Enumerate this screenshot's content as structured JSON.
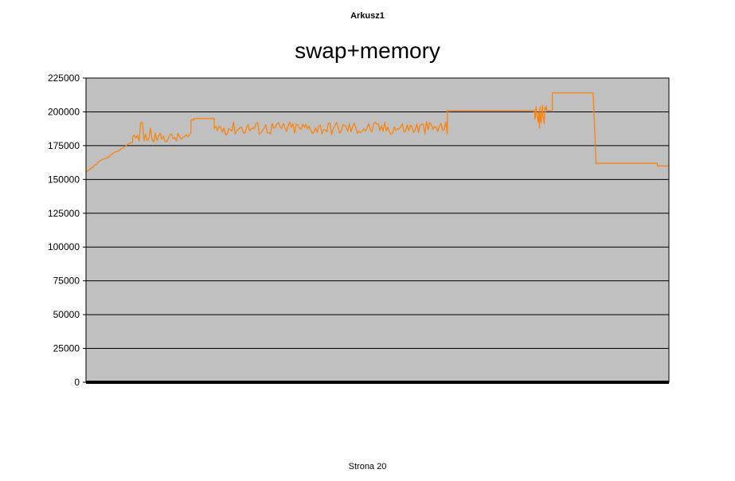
{
  "sheet_name": "Arkusz1",
  "page_label": "Strona 20",
  "chart_data": {
    "type": "line",
    "title": "swap+memory",
    "xlabel": "",
    "ylabel": "",
    "ylim": [
      0,
      225000
    ],
    "yticks": [
      0,
      25000,
      50000,
      75000,
      100000,
      125000,
      150000,
      175000,
      200000,
      225000
    ],
    "series": [
      {
        "name": "swap+memory",
        "color": "#ff7f00",
        "segments": [
          {
            "kind": "ramp",
            "x0": 0.0,
            "x1": 0.02,
            "y0": 155000,
            "y1": 162000
          },
          {
            "kind": "ramp",
            "x0": 0.02,
            "x1": 0.08,
            "y0": 162000,
            "y1": 178000
          },
          {
            "kind": "noisy",
            "x0": 0.08,
            "x1": 0.18,
            "base": 181000,
            "amp": 3500,
            "spikes": [
              {
                "x": 0.095,
                "y": 192000
              },
              {
                "x": 0.11,
                "y": 188000
              }
            ]
          },
          {
            "kind": "flat",
            "x0": 0.18,
            "x1": 0.185,
            "y": 194000
          },
          {
            "kind": "flat",
            "x0": 0.185,
            "x1": 0.22,
            "y": 195000
          },
          {
            "kind": "noisy",
            "x0": 0.22,
            "x1": 0.62,
            "base": 188000,
            "amp": 5000,
            "spikes": []
          },
          {
            "kind": "flat",
            "x0": 0.62,
            "x1": 0.77,
            "y": 201000
          },
          {
            "kind": "noisy",
            "x0": 0.77,
            "x1": 0.79,
            "base": 198000,
            "amp": 7000,
            "spikes": [
              {
                "x": 0.778,
                "y": 188000
              }
            ]
          },
          {
            "kind": "flat",
            "x0": 0.79,
            "x1": 0.8,
            "y": 201000
          },
          {
            "kind": "flat",
            "x0": 0.8,
            "x1": 0.87,
            "y": 214000
          },
          {
            "kind": "ramp",
            "x0": 0.87,
            "x1": 0.875,
            "y0": 214000,
            "y1": 162000
          },
          {
            "kind": "flat",
            "x0": 0.875,
            "x1": 0.98,
            "y": 162000
          },
          {
            "kind": "flat",
            "x0": 0.98,
            "x1": 1.0,
            "y": 160000
          }
        ]
      }
    ]
  }
}
